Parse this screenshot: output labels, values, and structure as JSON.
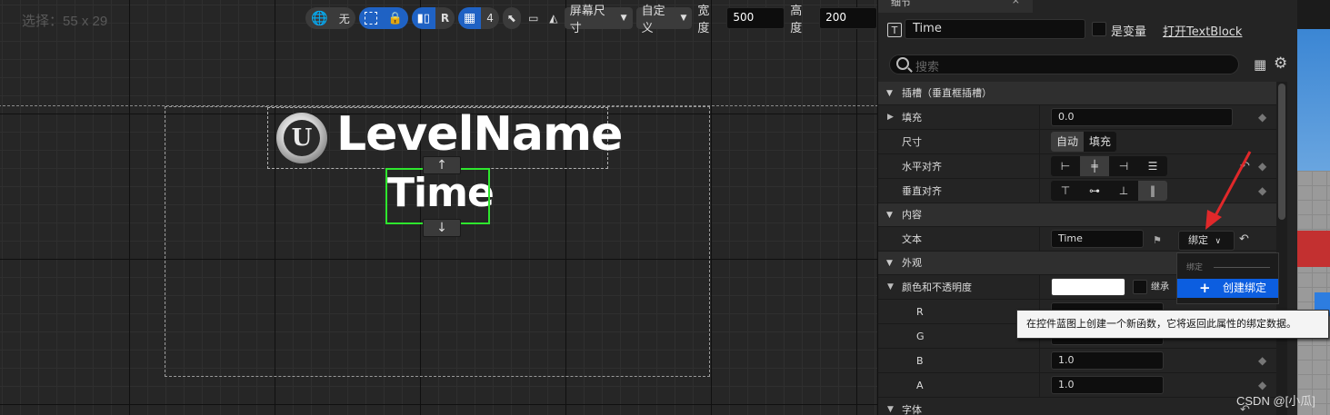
{
  "canvas": {
    "selection_size": "选择：55 x 29",
    "level_name": "LevelName",
    "logo_letter": "U",
    "time_text": "Time",
    "arrow_up": "↑",
    "arrow_down": "↓"
  },
  "toolbar": {
    "localize_value": "无",
    "r_label": "R",
    "grid_value": "4",
    "screen_size": "屏幕尺寸",
    "custom": "自定义",
    "width_label": "宽度",
    "width_value": "500",
    "height_label": "高度",
    "height_value": "200"
  },
  "panel": {
    "tab_title": "细节",
    "widget_name": "Time",
    "is_variable": "是变量",
    "open_link": "打开TextBlock",
    "search_placeholder": "搜索",
    "cat_slot": "插槽（垂直框插槽）",
    "padding_label": "填充",
    "padding_value": "0.0",
    "size_label": "尺寸",
    "size_auto": "自动",
    "size_fill": "填充",
    "halign_label": "水平对齐",
    "valign_label": "垂直对齐",
    "cat_content": "内容",
    "text_label": "文本",
    "text_value": "Time",
    "bind_button": "绑定",
    "cat_appearance": "外观",
    "color_label": "颜色和不透明度",
    "inherit_label": "继承",
    "r_label": "R",
    "g_label": "G",
    "b_label": "B",
    "b_value": "1.0",
    "a_label": "A",
    "a_value": "1.0",
    "font_label": "字体"
  },
  "bind_menu": {
    "header": "绑定",
    "create": "创建绑定"
  },
  "tooltip": "在控件蓝图上创建一个新函数，它将返回此属性的绑定数据。",
  "watermark": "CSDN @[小瓜]",
  "colors": {
    "selection_green": "#2ee62e",
    "accent_blue": "#0c5ee0",
    "annotation_red": "#e0282a"
  }
}
